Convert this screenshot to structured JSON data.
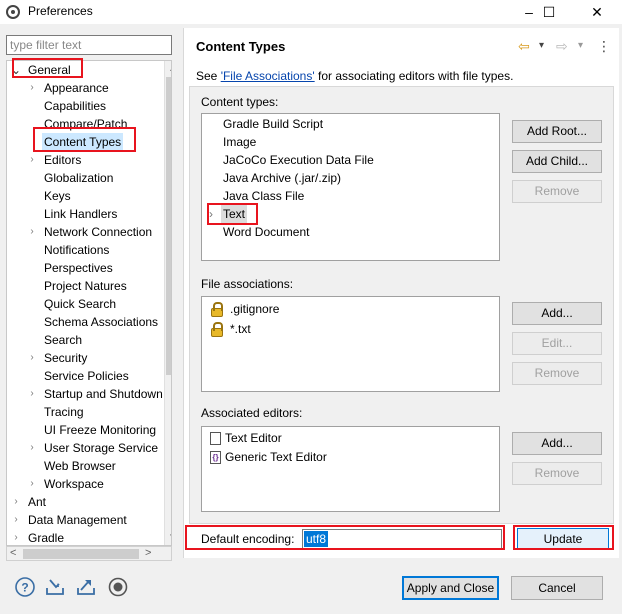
{
  "window": {
    "title": "Preferences",
    "controls": {
      "minimize": "–",
      "maximize": "☐",
      "close": "✕"
    }
  },
  "filter": {
    "placeholder": "type filter text"
  },
  "tree": {
    "items": [
      {
        "label": "General",
        "twisty": "⌄"
      },
      {
        "label": "Appearance",
        "twisty": "›"
      },
      {
        "label": "Capabilities",
        "twisty": ""
      },
      {
        "label": "Compare/Patch",
        "twisty": ""
      },
      {
        "label": "Content Types",
        "twisty": ""
      },
      {
        "label": "Editors",
        "twisty": "›"
      },
      {
        "label": "Globalization",
        "twisty": ""
      },
      {
        "label": "Keys",
        "twisty": ""
      },
      {
        "label": "Link Handlers",
        "twisty": ""
      },
      {
        "label": "Network Connection",
        "twisty": "›"
      },
      {
        "label": "Notifications",
        "twisty": ""
      },
      {
        "label": "Perspectives",
        "twisty": ""
      },
      {
        "label": "Project Natures",
        "twisty": ""
      },
      {
        "label": "Quick Search",
        "twisty": ""
      },
      {
        "label": "Schema Associations",
        "twisty": ""
      },
      {
        "label": "Search",
        "twisty": ""
      },
      {
        "label": "Security",
        "twisty": "›"
      },
      {
        "label": "Service Policies",
        "twisty": ""
      },
      {
        "label": "Startup and Shutdown",
        "twisty": "›"
      },
      {
        "label": "Tracing",
        "twisty": ""
      },
      {
        "label": "UI Freeze Monitoring",
        "twisty": ""
      },
      {
        "label": "User Storage Service",
        "twisty": "›"
      },
      {
        "label": "Web Browser",
        "twisty": ""
      },
      {
        "label": "Workspace",
        "twisty": "›"
      },
      {
        "label": "Ant",
        "twisty": "›"
      },
      {
        "label": "Data Management",
        "twisty": "›"
      },
      {
        "label": "Gradle",
        "twisty": "›"
      }
    ],
    "scroll_up": "▲",
    "scroll_down": "▼",
    "scroll_left": "<",
    "scroll_right": ">"
  },
  "page": {
    "title": "Content Types",
    "see_prefix": "See ",
    "see_link": "'File Associations'",
    "see_suffix": " for associating editors with file types.",
    "nav_back": "⇦",
    "nav_forward": "⇨",
    "nav_dropdown": "▾",
    "nav_menu": "⋮"
  },
  "content_types": {
    "label": "Content types:",
    "items": [
      {
        "label": "Gradle Build Script",
        "twisty": ""
      },
      {
        "label": "Image",
        "twisty": ""
      },
      {
        "label": "JaCoCo Execution Data File",
        "twisty": ""
      },
      {
        "label": "Java Archive (.jar/.zip)",
        "twisty": ""
      },
      {
        "label": "Java Class File",
        "twisty": ""
      },
      {
        "label": "Text",
        "twisty": "›"
      },
      {
        "label": "Word Document",
        "twisty": ""
      }
    ],
    "buttons": {
      "add_root": "Add Root...",
      "add_child": "Add Child...",
      "remove": "Remove"
    }
  },
  "file_associations": {
    "label": "File associations:",
    "items": [
      ".gitignore",
      "*.txt"
    ],
    "buttons": {
      "add": "Add...",
      "edit": "Edit...",
      "remove": "Remove"
    }
  },
  "associated_editors": {
    "label": "Associated editors:",
    "items": [
      "Text Editor",
      "Generic Text Editor"
    ],
    "buttons": {
      "add": "Add...",
      "remove": "Remove"
    }
  },
  "encoding": {
    "label": "Default encoding:",
    "value": "utf8",
    "update_label": "Update"
  },
  "footer": {
    "apply_close": "Apply and Close",
    "cancel": "Cancel",
    "help_glyph": "?"
  },
  "colors": {
    "highlight": "#e8141e",
    "selection": "#0078d7",
    "link": "#0645ad"
  }
}
